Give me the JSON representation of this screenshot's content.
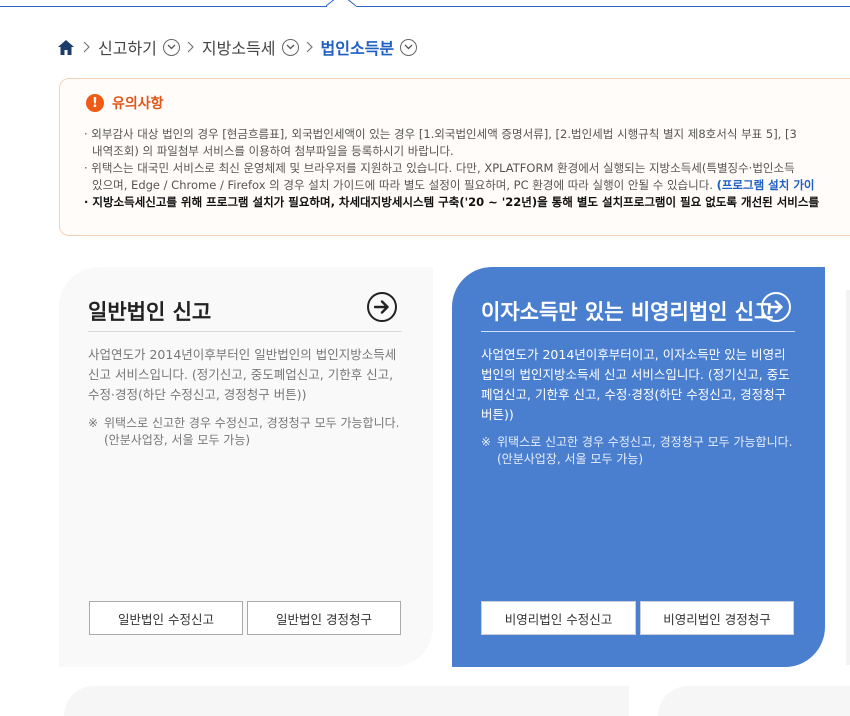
{
  "breadcrumb": {
    "home_icon": "home-icon",
    "items": [
      {
        "label": "신고하기"
      },
      {
        "label": "지방소득세"
      },
      {
        "label": "법인소득분"
      }
    ]
  },
  "notice": {
    "icon": "exclamation-icon",
    "title": "유의사항",
    "lines": [
      "· 외부감사 대상 법인의 경우 [현금흐름표], 외국법인세액이 있는 경우 [1.외국법인세액 증명서류], [2.법인세법 시행규칙 별지 제8호서식 부표 5], [3",
      "내역조회) 의 파일첨부 서비스를 이용하여 첨부파일을 등록하시기 바랍니다.",
      "· 위택스는 대국민 서비스로 최신 운영체제 및 브라우저를 지원하고 있습니다. 다만, XPLATFORM 환경에서 실행되는 지방소득세(특별징수·법인소득",
      "있으며, Edge / Chrome / Firefox 의 경우 설치 가이드에 따라 별도 설정이 필요하며, PC 환경에 따라 실행이 안될 수 있습니다.",
      "(프로그램 설치 가이",
      "· 지방소득세신고를 위해 프로그램 설치가 필요하며, 차세대지방세시스템 구축('20 ~ '22년)을 통해 별도 설치프로그램이 필요 없도록 개선된 서비스를"
    ]
  },
  "cards": [
    {
      "title": "일반법인 신고",
      "description": "사업연도가 2014년이후부터인 일반법인의 법인지방소득세 신고 서비스입니다. (정기신고, 중도폐업신고, 기한후 신고, 수정·경정(하단 수정신고, 경정청구 버튼))",
      "note_mark": "※",
      "note_line1": "위택스로 신고한 경우 수정신고, 경정청구 모두 가능합니다.",
      "note_line2": "(안분사업장, 서울 모두 가능)",
      "button1": "일반법인 수정신고",
      "button2": "일반법인 경정청구"
    },
    {
      "title": "이자소득만 있는 비영리법인 신고",
      "description": "사업연도가 2014년이후부터이고, 이자소득만 있는 비영리법인의 법인지방소득세 신고 서비스입니다. (정기신고, 중도폐업신고, 기한후 신고, 수정·경정(하단 수정신고, 경정청구 버튼))",
      "note_mark": "※",
      "note_line1": "위택스로 신고한 경우 수정신고, 경정청구 모두 가능합니다.",
      "note_line2": "(안분사업장, 서울 모두 가능)",
      "button1": "비영리법인 수정신고",
      "button2": "비영리법인 경정청구"
    }
  ],
  "colors": {
    "accent_blue": "#1f5fc4",
    "card_blue": "#4a7fd0",
    "warning_orange": "#ef5a15"
  }
}
